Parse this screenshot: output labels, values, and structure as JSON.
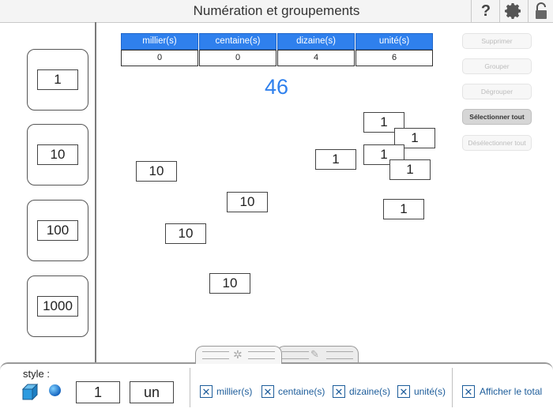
{
  "header": {
    "title": "Numération et groupements",
    "help_icon": "question-icon",
    "settings_icon": "gear-icon",
    "lock_icon": "lock-icon"
  },
  "source_cards": [
    "1",
    "10",
    "100",
    "1000"
  ],
  "place_table": {
    "headers": [
      "millier(s)",
      "centaine(s)",
      "dizaine(s)",
      "unité(s)"
    ],
    "values": [
      "0",
      "0",
      "4",
      "6"
    ]
  },
  "total": "46",
  "side_buttons": {
    "delete": "Supprimer",
    "group": "Grouper",
    "ungroup": "Dégrouper",
    "select_all": "Sélectionner tout",
    "deselect_all": "Désélectionner tout"
  },
  "tiles": [
    "1",
    "1",
    "1",
    "1",
    "1",
    "1",
    "10",
    "10",
    "10",
    "10"
  ],
  "bottom": {
    "style_label": "style :",
    "number_value": "1",
    "word_value": "un",
    "checkboxes": [
      "millier(s)",
      "centaine(s)",
      "dizaine(s)",
      "unité(s)",
      "Afficher le total"
    ],
    "check_mark": "✕"
  }
}
